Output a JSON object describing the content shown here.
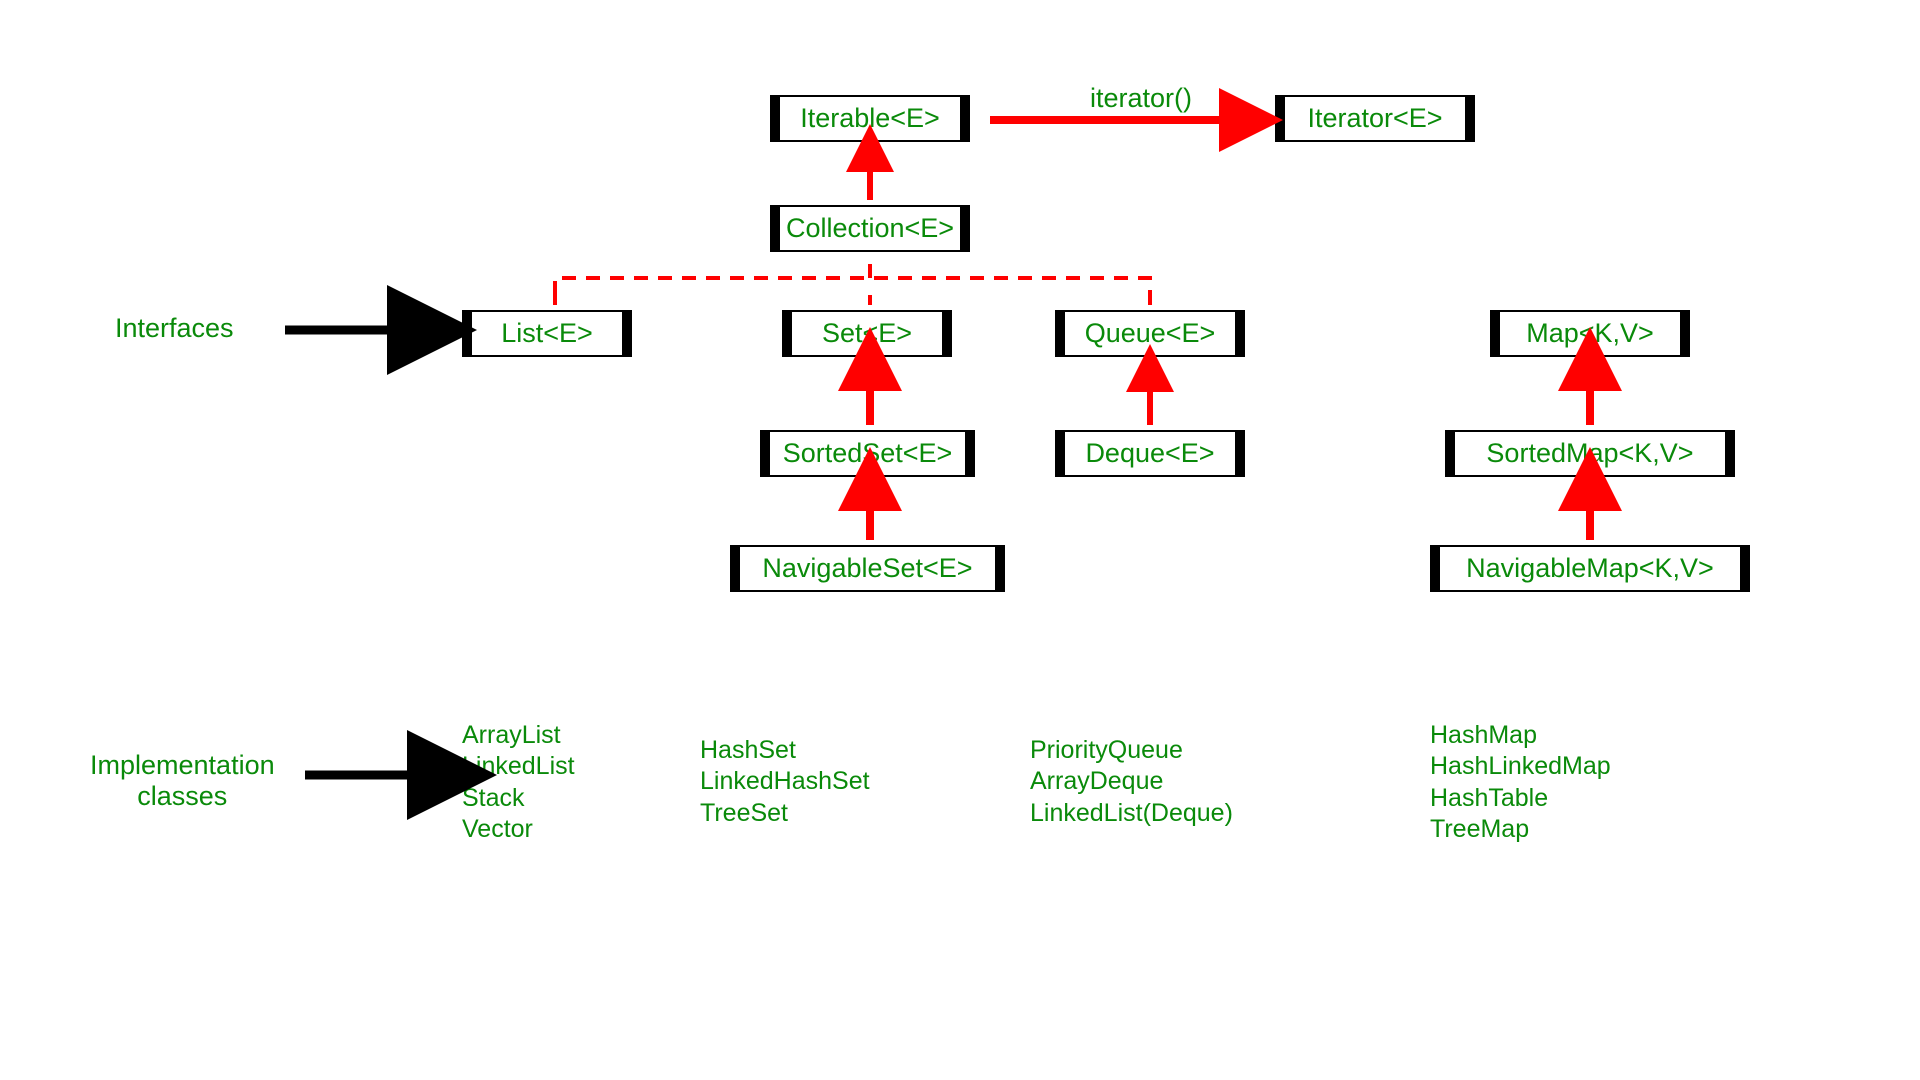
{
  "labels": {
    "interfaces": "Interfaces",
    "implementationClasses": "Implementation\nclasses",
    "iteratorMethod": "iterator()"
  },
  "boxes": {
    "iterable": "Iterable<E>",
    "iterator": "Iterator<E>",
    "collection": "Collection<E>",
    "list": "List<E>",
    "set": "Set<E>",
    "queue": "Queue<E>",
    "sortedSet": "SortedSet<E>",
    "deque": "Deque<E>",
    "navigableSet": "NavigableSet<E>",
    "map": "Map<K,V>",
    "sortedMap": "SortedMap<K,V>",
    "navigableMap": "NavigableMap<K,V>"
  },
  "impls": {
    "list": [
      "ArrayList",
      "LinkedList",
      "Stack",
      "Vector"
    ],
    "set": [
      "HashSet",
      "LinkedHashSet",
      "TreeSet"
    ],
    "queue": [
      "PriorityQueue",
      "ArrayDeque",
      "LinkedList(Deque)"
    ],
    "map": [
      "HashMap",
      "HashLinkedMap",
      "HashTable",
      "TreeMap"
    ]
  }
}
